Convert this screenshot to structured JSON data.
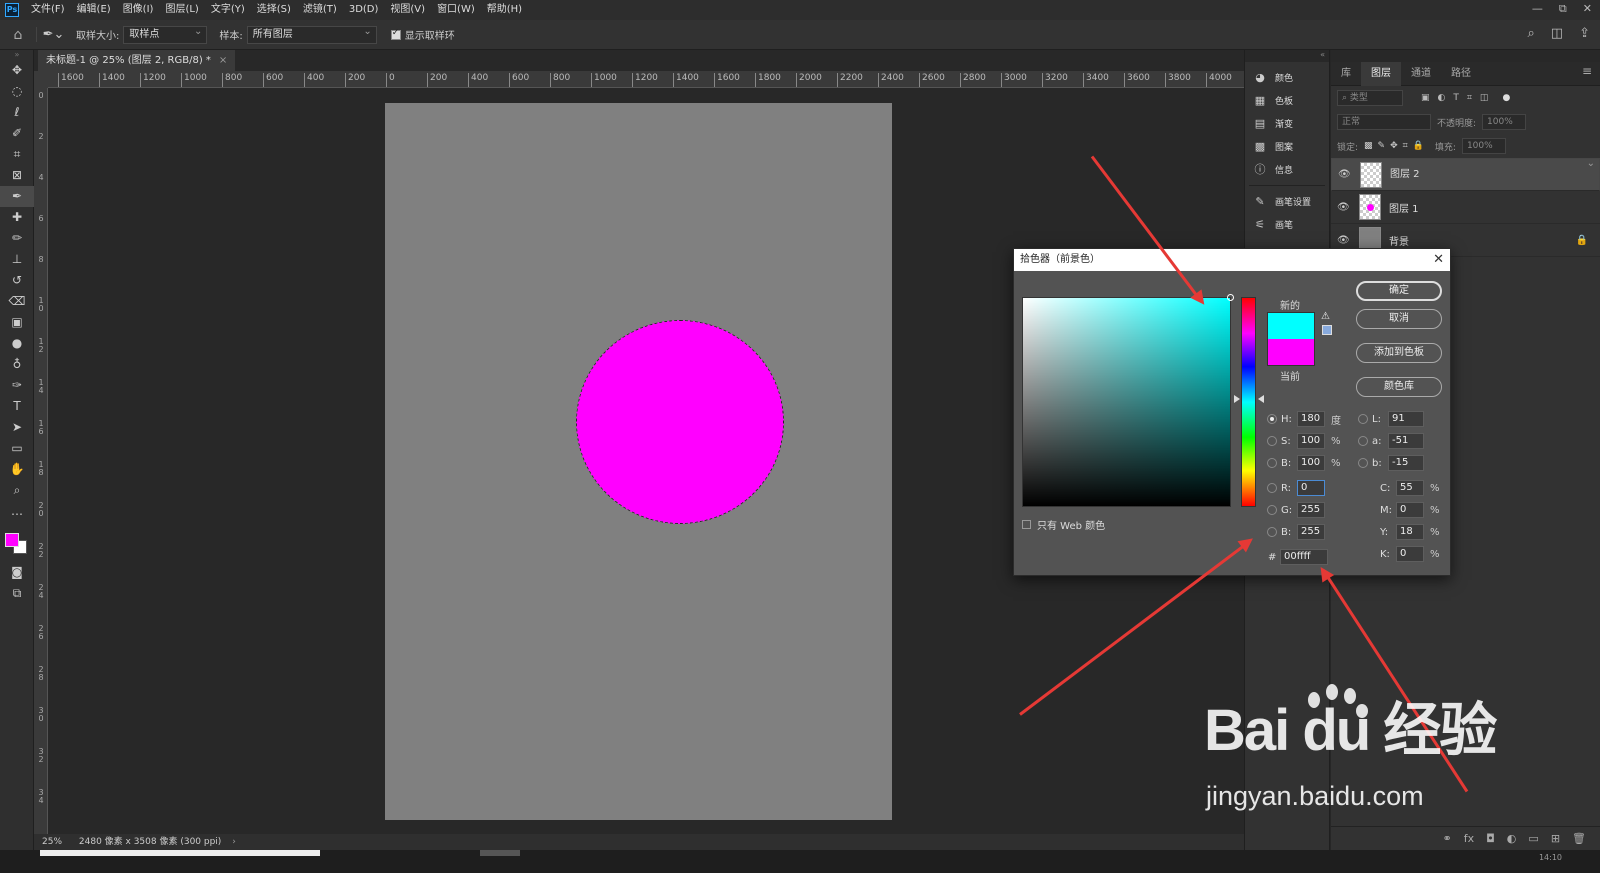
{
  "menubar": {
    "logo": "Ps",
    "items": [
      "文件(F)",
      "编辑(E)",
      "图像(I)",
      "图层(L)",
      "文字(Y)",
      "选择(S)",
      "滤镜(T)",
      "3D(D)",
      "视图(V)",
      "窗口(W)",
      "帮助(H)"
    ],
    "window_controls": [
      "—",
      "⧉",
      "✕"
    ]
  },
  "options": {
    "sample_size_label": "取样大小:",
    "sample_size_value": "取样点",
    "sample_label": "样本:",
    "sample_value": "所有图层",
    "show_ring_label": "显示取样环"
  },
  "document": {
    "tab_title": "未标题-1 @ 25% (图层 2, RGB/8) *"
  },
  "ruler_h": [
    "1600",
    "1400",
    "1200",
    "1000",
    "800",
    "600",
    "400",
    "200",
    "0",
    "200",
    "400",
    "600",
    "800",
    "1000",
    "1200",
    "1400",
    "1600",
    "1800",
    "2000",
    "2200",
    "2400",
    "2600",
    "2800",
    "3000",
    "3200",
    "3400",
    "3600",
    "3800",
    "4000"
  ],
  "ruler_v": [
    "0",
    "2",
    "4",
    "6",
    "8",
    "1 0",
    "1 2",
    "1 4",
    "1 6",
    "1 8",
    "2 0",
    "2 2",
    "2 4",
    "2 6",
    "2 8",
    "3 0",
    "3 2",
    "3 4"
  ],
  "status": {
    "zoom": "25%",
    "doc_size": "2480 像素 x 3508 像素 (300 ppi)"
  },
  "bottom": {
    "time": "14:10"
  },
  "midpanel": {
    "items": [
      {
        "icon": "palette-icon",
        "glyph": "◕",
        "label": "颜色"
      },
      {
        "icon": "swatches-icon",
        "glyph": "▦",
        "label": "色板"
      },
      {
        "icon": "gradient-icon",
        "glyph": "▤",
        "label": "渐变"
      },
      {
        "icon": "pattern-icon",
        "glyph": "▩",
        "label": "图案"
      },
      {
        "icon": "info-icon",
        "glyph": "ⓘ",
        "label": "信息"
      }
    ],
    "items2": [
      {
        "icon": "brush-settings-icon",
        "glyph": "✎",
        "label": "画笔设置"
      },
      {
        "icon": "brush-icon",
        "glyph": "⚟",
        "label": "画笔"
      }
    ]
  },
  "layers_panel": {
    "tabs": [
      "库",
      "图层",
      "通道",
      "路径"
    ],
    "active_tab": 1,
    "filter_placeholder": "类型",
    "blend_mode": "正常",
    "opacity_label": "不透明度:",
    "opacity_value": "100%",
    "lock_label": "锁定:",
    "fill_label": "填充:",
    "fill_value": "100%",
    "layers": [
      {
        "name": "图层 2",
        "selected": true,
        "type": "transparent"
      },
      {
        "name": "图层 1",
        "selected": false,
        "type": "circle"
      },
      {
        "name": "背景",
        "selected": false,
        "type": "background"
      }
    ],
    "footer_icons": [
      "⚭",
      "fx",
      "◘",
      "◐",
      "▭",
      "⊞",
      "🗑"
    ]
  },
  "color_picker": {
    "title": "拾色器（前景色）",
    "new_label": "新的",
    "current_label": "当前",
    "new_color": "#00ffff",
    "current_color": "#ff00ff",
    "buttons": {
      "ok": "确定",
      "cancel": "取消",
      "add_swatch": "添加到色板",
      "color_library": "颜色库"
    },
    "H": {
      "label": "H:",
      "value": "180",
      "unit": "度"
    },
    "S": {
      "label": "S:",
      "value": "100",
      "unit": "%"
    },
    "Bv": {
      "label": "B:",
      "value": "100",
      "unit": "%"
    },
    "R": {
      "label": "R:",
      "value": "0"
    },
    "G": {
      "label": "G:",
      "value": "255"
    },
    "Bl": {
      "label": "B:",
      "value": "255"
    },
    "L": {
      "label": "L:",
      "value": "91"
    },
    "a": {
      "label": "a:",
      "value": "-51"
    },
    "b": {
      "label": "b:",
      "value": "-15"
    },
    "C": {
      "label": "C:",
      "value": "55",
      "unit": "%"
    },
    "M": {
      "label": "M:",
      "value": "0",
      "unit": "%"
    },
    "Y": {
      "label": "Y:",
      "value": "18",
      "unit": "%"
    },
    "K": {
      "label": "K:",
      "value": "0",
      "unit": "%"
    },
    "hex_label": "#",
    "hex": "00ffff",
    "web_only": "只有 Web 颜色"
  },
  "colors": {
    "foreground": "#ff00ff",
    "background": "#ffffff",
    "circle": "#ff00ff",
    "canvas": "#808080",
    "annotation": "#e53935"
  },
  "watermark": {
    "brand": "Bai  du 经验",
    "url": "jingyan.baidu.com"
  }
}
